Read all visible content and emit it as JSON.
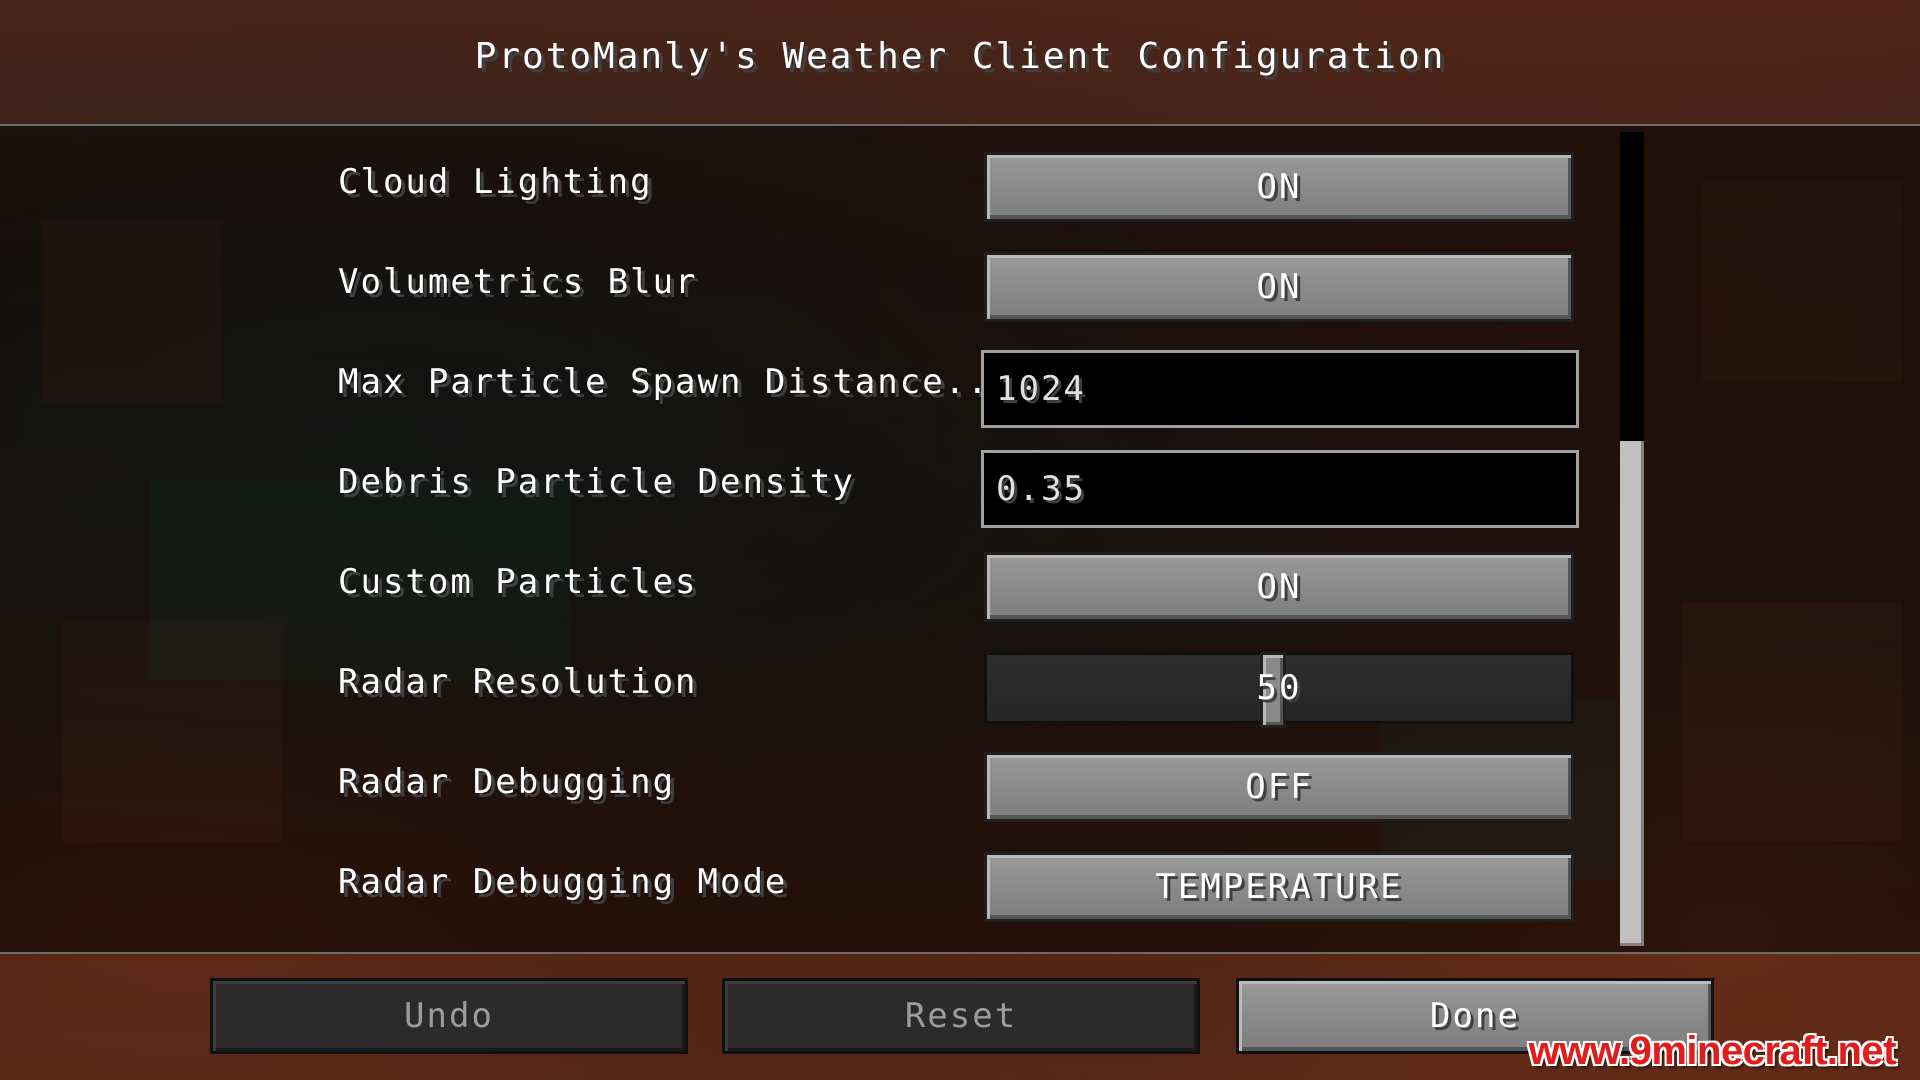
{
  "screen": {
    "title": "ProtoManly's Weather Client Configuration"
  },
  "options": [
    {
      "label": "Cloud Lighting",
      "type": "toggle",
      "value": "ON"
    },
    {
      "label": "Volumetrics Blur",
      "type": "toggle",
      "value": "ON"
    },
    {
      "label": "Max Particle Spawn Distance...",
      "type": "text",
      "value": "1024"
    },
    {
      "label": "Debris Particle Density",
      "type": "text",
      "value": "0.35"
    },
    {
      "label": "Custom Particles",
      "type": "toggle",
      "value": "ON"
    },
    {
      "label": "Radar Resolution",
      "type": "slider",
      "value": "50",
      "slider_fraction": 0.49
    },
    {
      "label": "Radar Debugging",
      "type": "toggle",
      "value": "OFF"
    },
    {
      "label": "Radar Debugging Mode",
      "type": "toggle",
      "value": "TEMPERATURE"
    }
  ],
  "scroll": {
    "thumb_start_fraction": 0.38,
    "thumb_end_fraction": 1.0
  },
  "footer": {
    "undo_label": "Undo",
    "reset_label": "Reset",
    "done_label": "Done"
  },
  "watermark": "www.9minecraft.net",
  "colors": {
    "button_face": "#8a8a8a",
    "disabled_button_face": "#2b2b2b",
    "watermark_red": "#e21b1b"
  }
}
